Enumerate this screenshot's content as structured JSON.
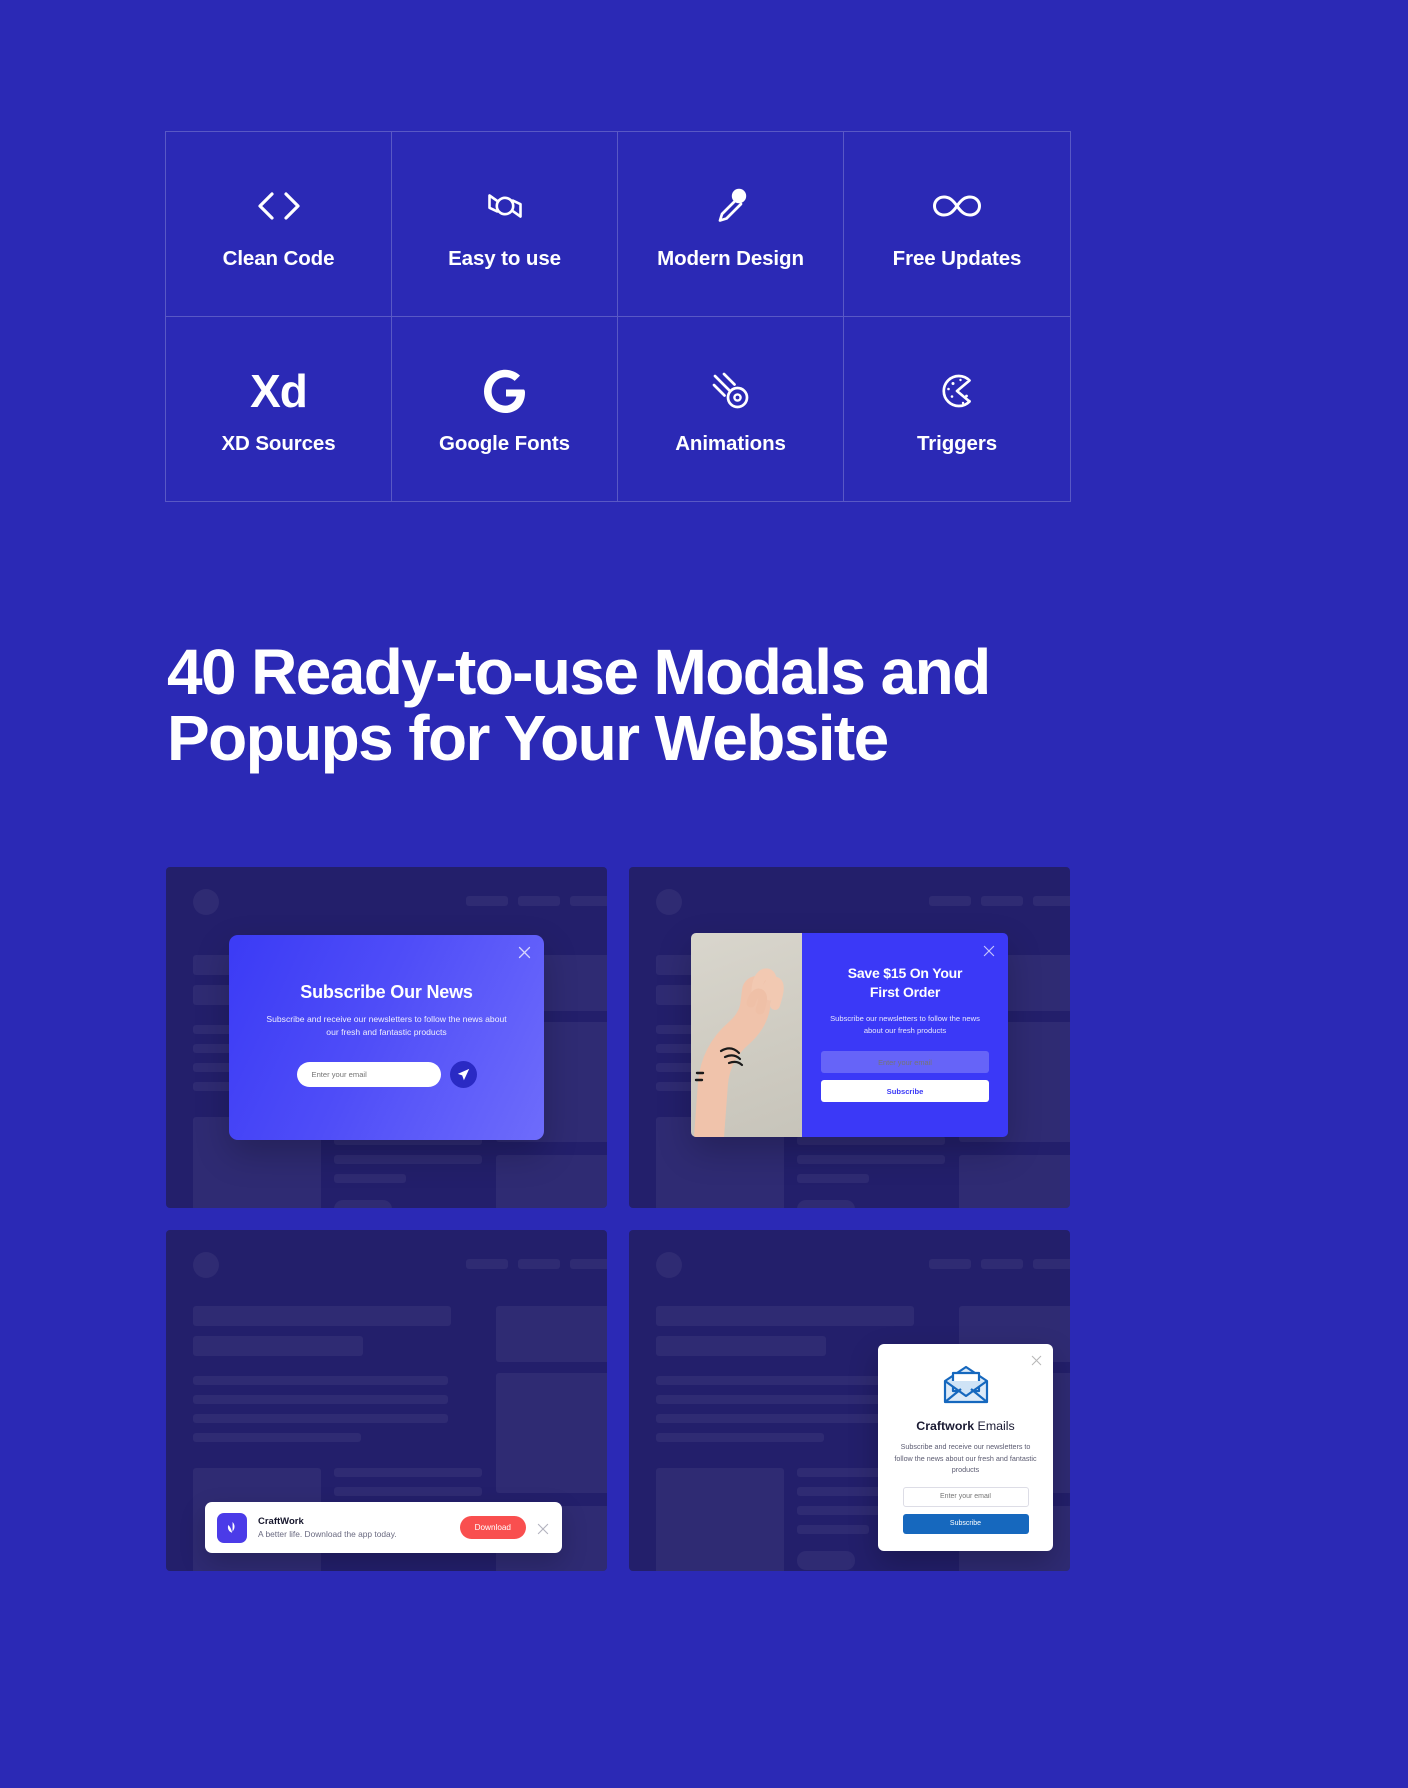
{
  "page": {
    "background_color": "#2B29B5",
    "headline_lines": [
      "40 Ready-to-use Modals and",
      "Popups for Your Website"
    ]
  },
  "features": {
    "items": [
      {
        "icon": "code-brackets-icon",
        "label": "Clean Code"
      },
      {
        "icon": "candy-icon",
        "label": "Easy to use"
      },
      {
        "icon": "eyedropper-icon",
        "label": "Modern Design"
      },
      {
        "icon": "infinity-icon",
        "label": "Free Updates"
      },
      {
        "icon": "adobe-xd-icon",
        "label": "XD Sources",
        "mark": "Xd"
      },
      {
        "icon": "google-g-icon",
        "label": "Google Fonts",
        "mark": "G"
      },
      {
        "icon": "comet-icon",
        "label": "Animations"
      },
      {
        "icon": "cursor-click-icon",
        "label": "Triggers"
      }
    ]
  },
  "showcase": {
    "cards": [
      {
        "name": "subscribe-our-news",
        "modal": {
          "title": "Subscribe Our News",
          "body": "Subscribe and receive our newsletters to follow the news about our fresh and fantastic products",
          "email_placeholder": "Enter your email",
          "send_icon": "paper-plane-icon",
          "close_icon": "close-icon",
          "accent": "#4F4DF8"
        }
      },
      {
        "name": "save-15-first-order",
        "modal": {
          "title_lines": [
            "Save $15 On Your",
            "First Order"
          ],
          "body": "Subscribe our newsletters to follow the news about our fresh products",
          "email_placeholder": "Enter your email",
          "submit_label": "Subscribe",
          "close_icon": "close-icon",
          "accent": "#3B39F7",
          "image_alt": "photo-arm-raised-hand"
        }
      },
      {
        "name": "craftwork-download-banner",
        "banner": {
          "app_name": "CraftWork",
          "tagline": "A better life. Download the app today.",
          "cta_label": "Download",
          "cta_color": "#F94F4F",
          "logo_icon": "craftwork-leaf-icon",
          "close_icon": "close-icon"
        }
      },
      {
        "name": "craftwork-emails",
        "modal": {
          "title_bold": "Craftwork",
          "title_rest": " Emails",
          "body": "Subscribe and receive our newsletters to follow the news about our fresh and fantastic products",
          "email_placeholder": "Enter your email",
          "submit_label": "Subscribe",
          "submit_color": "#1668BE",
          "hero_icon": "open-envelope-icon",
          "close_icon": "close-icon"
        }
      }
    ]
  }
}
